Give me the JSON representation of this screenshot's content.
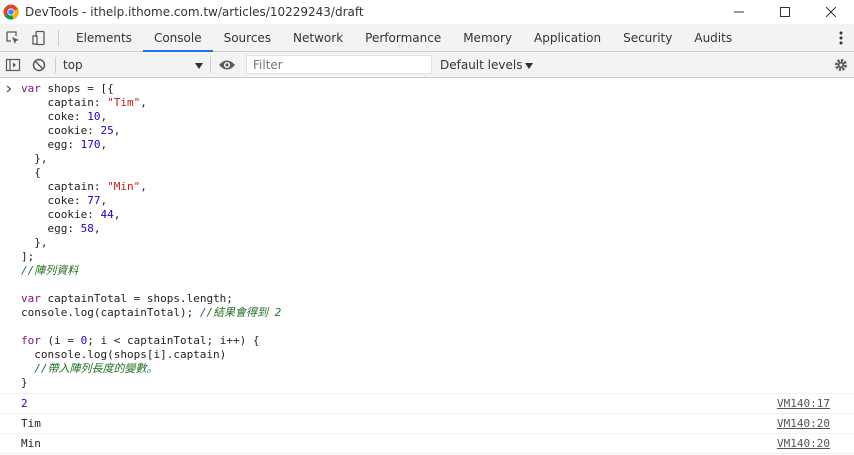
{
  "window": {
    "title": "DevTools - ithelp.ithome.com.tw/articles/10229243/draft"
  },
  "tabs": [
    {
      "label": "Elements"
    },
    {
      "label": "Console",
      "active": true
    },
    {
      "label": "Sources"
    },
    {
      "label": "Network"
    },
    {
      "label": "Performance"
    },
    {
      "label": "Memory"
    },
    {
      "label": "Application"
    },
    {
      "label": "Security"
    },
    {
      "label": "Audits"
    }
  ],
  "console_toolbar": {
    "context": "top",
    "filter_placeholder": "Filter",
    "levels": "Default levels"
  },
  "code": [
    [
      [
        "kw",
        "var "
      ],
      [
        "",
        "shops = [{"
      ]
    ],
    [
      [
        "",
        "    captain: "
      ],
      [
        "str",
        "\"Tim\""
      ],
      [
        "",
        ","
      ]
    ],
    [
      [
        "",
        "    coke: "
      ],
      [
        "num",
        "10"
      ],
      [
        "",
        ","
      ]
    ],
    [
      [
        "",
        "    cookie: "
      ],
      [
        "num",
        "25"
      ],
      [
        "",
        ","
      ]
    ],
    [
      [
        "",
        "    egg: "
      ],
      [
        "num",
        "170"
      ],
      [
        "",
        ","
      ]
    ],
    [
      [
        "",
        "  },"
      ]
    ],
    [
      [
        "",
        "  {"
      ]
    ],
    [
      [
        "",
        "    captain: "
      ],
      [
        "str",
        "\"Min\""
      ],
      [
        "",
        ","
      ]
    ],
    [
      [
        "",
        "    coke: "
      ],
      [
        "num",
        "77"
      ],
      [
        "",
        ","
      ]
    ],
    [
      [
        "",
        "    cookie: "
      ],
      [
        "num",
        "44"
      ],
      [
        "",
        ","
      ]
    ],
    [
      [
        "",
        "    egg: "
      ],
      [
        "num",
        "58"
      ],
      [
        "",
        ","
      ]
    ],
    [
      [
        "",
        "  },"
      ]
    ],
    [
      [
        "",
        "];"
      ]
    ],
    [
      [
        "cm",
        "//陣列資料"
      ]
    ],
    [
      [
        "",
        ""
      ]
    ],
    [
      [
        "kw",
        "var "
      ],
      [
        "",
        "captainTotal = shops.length;"
      ]
    ],
    [
      [
        "",
        "console.log(captainTotal); "
      ],
      [
        "cm",
        "//結果會得到 2"
      ]
    ],
    [
      [
        "",
        ""
      ]
    ],
    [
      [
        "kw",
        "for "
      ],
      [
        "",
        "(i = "
      ],
      [
        "num",
        "0"
      ],
      [
        "",
        "; i < captainTotal; i++) {"
      ]
    ],
    [
      [
        "",
        "  console.log(shops[i].captain)"
      ]
    ],
    [
      [
        "cm",
        "  //帶入陣列長度的變數。"
      ]
    ],
    [
      [
        "",
        "}"
      ]
    ]
  ],
  "outputs": [
    {
      "value": "2",
      "number": true,
      "source": "VM140:17"
    },
    {
      "value": "Tim",
      "number": false,
      "source": "VM140:20"
    },
    {
      "value": "Min",
      "number": false,
      "source": "VM140:20"
    }
  ]
}
